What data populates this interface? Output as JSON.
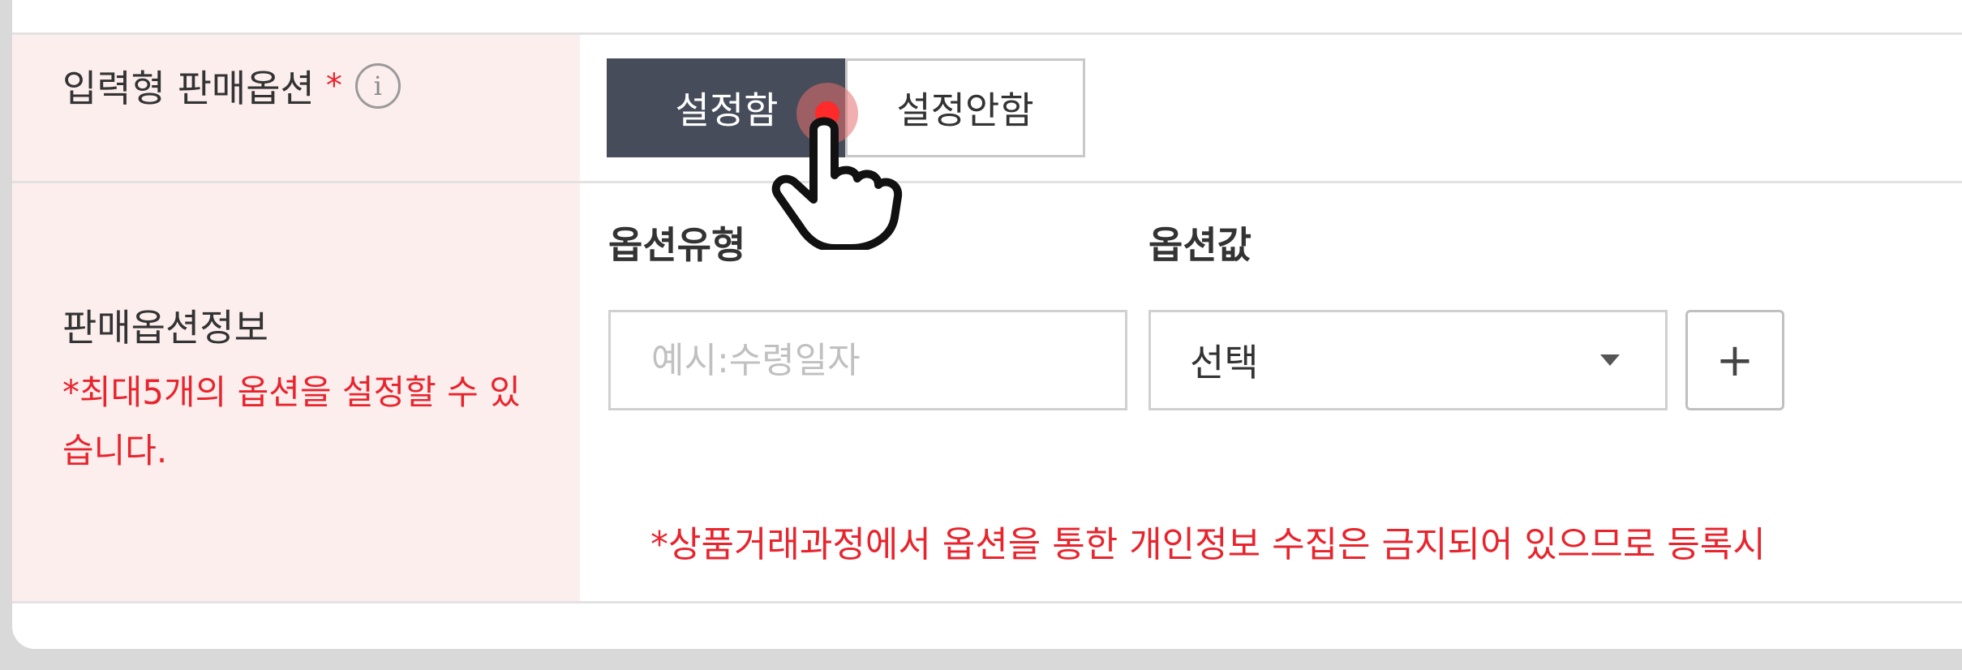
{
  "row_input_option": {
    "label": "입력형 판매옵션",
    "required_mark": "*",
    "info_icon": "i",
    "toggle_on_label": "설정함",
    "toggle_off_label": "설정안함"
  },
  "row_option_info": {
    "label": "판매옵션정보",
    "note": "*최대5개의 옵션을 설정할 수 있습니다.",
    "option_type_header": "옵션유형",
    "option_value_header": "옵션값",
    "option_type_placeholder": "예시:수령일자",
    "option_value_selected": "선택",
    "add_button_label": "+",
    "warning_text": "*상품거래과정에서 옵션을 통한 개인정보 수집은 금지되어 있으므로 등록시"
  },
  "icons": {
    "info": "info-icon",
    "dropdown": "chevron-down-icon",
    "cursor": "hand-pointer-icon"
  },
  "colors": {
    "label_bg": "#fdeeee",
    "accent_red": "#e8242d",
    "toggle_active_bg": "#464c5a",
    "page_bg": "#d9d9d9"
  }
}
